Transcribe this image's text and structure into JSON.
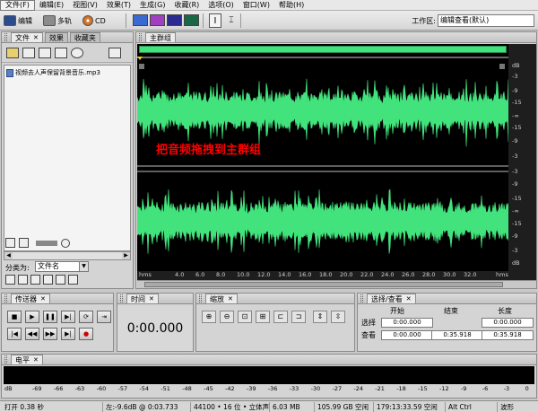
{
  "menu": [
    "文件(F)",
    "编辑(E)",
    "视图(V)",
    "效果(T)",
    "生成(G)",
    "收藏(R)",
    "选项(O)",
    "窗口(W)",
    "帮助(H)"
  ],
  "toolbar": {
    "edit_label": "编辑",
    "multitrack_label": "多轨",
    "cd_label": "CD",
    "workspace_label": "工作区:",
    "workspace_value": "编辑查看(默认)"
  },
  "files_panel": {
    "tabs": [
      "文件",
      "效果",
      "收藏夹"
    ],
    "file_name": "视频去人声保留背景音乐.mp3",
    "sort_label": "分类为:",
    "sort_value": "文件名"
  },
  "main_panel": {
    "tab": "主群组",
    "annotation": "把音频拖拽到主群组",
    "db_labels_top": [
      "dB",
      "-3",
      "-9",
      "-15",
      "-∞",
      "-15",
      "-9",
      "-3"
    ],
    "db_labels_bottom": [
      "-3",
      "-9",
      "-15",
      "-∞",
      "-15",
      "-9",
      "-3",
      "dB"
    ],
    "time_labels": [
      "hms",
      "4.0",
      "6.0",
      "8.0",
      "10.0",
      "12.0",
      "14.0",
      "16.0",
      "18.0",
      "20.0",
      "22.0",
      "24.0",
      "26.0",
      "28.0",
      "30.0",
      "32.0",
      "hms"
    ]
  },
  "transport": {
    "tab": "传送器"
  },
  "time_panel": {
    "tab": "时间",
    "value": "0:00.000"
  },
  "zoom_panel": {
    "tab": "缩放"
  },
  "selection_panel": {
    "tab": "选择/查看",
    "headers": [
      "开始",
      "结束",
      "长度"
    ],
    "rows": [
      {
        "label": "选择",
        "start": "0:00.000",
        "end": "",
        "length": "0:00.000"
      },
      {
        "label": "查看",
        "start": "0:00.000",
        "end": "0:35.918",
        "length": "0:35.918"
      }
    ]
  },
  "level_panel": {
    "tab": "电平",
    "scale": [
      "dB",
      "-69",
      "-66",
      "-63",
      "-60",
      "-57",
      "-54",
      "-51",
      "-48",
      "-45",
      "-42",
      "-39",
      "-36",
      "-33",
      "-30",
      "-27",
      "-24",
      "-21",
      "-18",
      "-15",
      "-12",
      "-9",
      "-6",
      "-3",
      "0"
    ]
  },
  "status": {
    "open": "打开 0.38 秒",
    "level": "左:-9.6dB @ 0:03.733",
    "format": "44100 • 16 位 • 立体声",
    "size": "6.03 MB",
    "space": "105.99 GB 空闲",
    "time_free": "179:13:33.59 空闲",
    "keys": "Alt Ctrl",
    "view": "波形"
  },
  "colors": {
    "waveform": "#42e27c",
    "background": "#000000",
    "annotation": "#ff0000"
  }
}
